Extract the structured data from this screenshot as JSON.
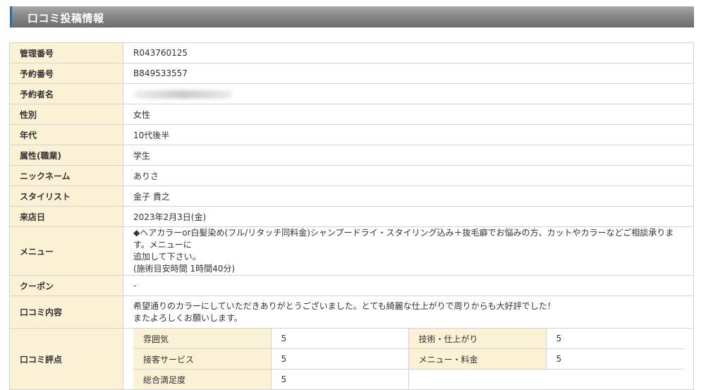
{
  "section": {
    "title": "口コミ投稿情報"
  },
  "rows": {
    "management_no": {
      "label": "管理番号",
      "value": "R043760125"
    },
    "reservation_no": {
      "label": "予約番号",
      "value": "B849533557"
    },
    "reserver_name": {
      "label": "予約者名"
    },
    "gender": {
      "label": "性別",
      "value": "女性"
    },
    "age": {
      "label": "年代",
      "value": "10代後半"
    },
    "occupation": {
      "label": "属性(職業)",
      "value": "学生"
    },
    "nickname": {
      "label": "ニックネーム",
      "value": "ありさ"
    },
    "stylist": {
      "label": "スタイリスト",
      "value": "金子 貴之"
    },
    "visit_date": {
      "label": "来店日",
      "value": "2023年2月3日(金)"
    },
    "menu": {
      "label": "メニュー",
      "line1": "◆ヘアカラーor白髪染め(フル/リタッチ同料金)シャンプードライ・スタイリング込み＋抜毛癖でお悩みの方、カットやカラーなどご相談承ります。メニューに",
      "line2": "追加して下さい。",
      "line3": "(施術目安時間 1時間40分)"
    },
    "coupon": {
      "label": "クーポン",
      "value": "-"
    },
    "review_content": {
      "label": "口コミ内容",
      "line1": "希望通りのカラーにしていただきありがとうございました。とても綺麗な仕上がりで周りからも大好評でした！",
      "line2": "またよろしくお願いします。"
    },
    "review_score": {
      "label": "口コミ評点",
      "atmosphere": {
        "label": "雰囲気",
        "value": "5"
      },
      "technique": {
        "label": "技術・仕上がり",
        "value": "5"
      },
      "service": {
        "label": "接客サービス",
        "value": "5"
      },
      "menu_price": {
        "label": "メニュー・料金",
        "value": "5"
      },
      "overall": {
        "label": "総合満足度",
        "value": "5"
      }
    }
  }
}
